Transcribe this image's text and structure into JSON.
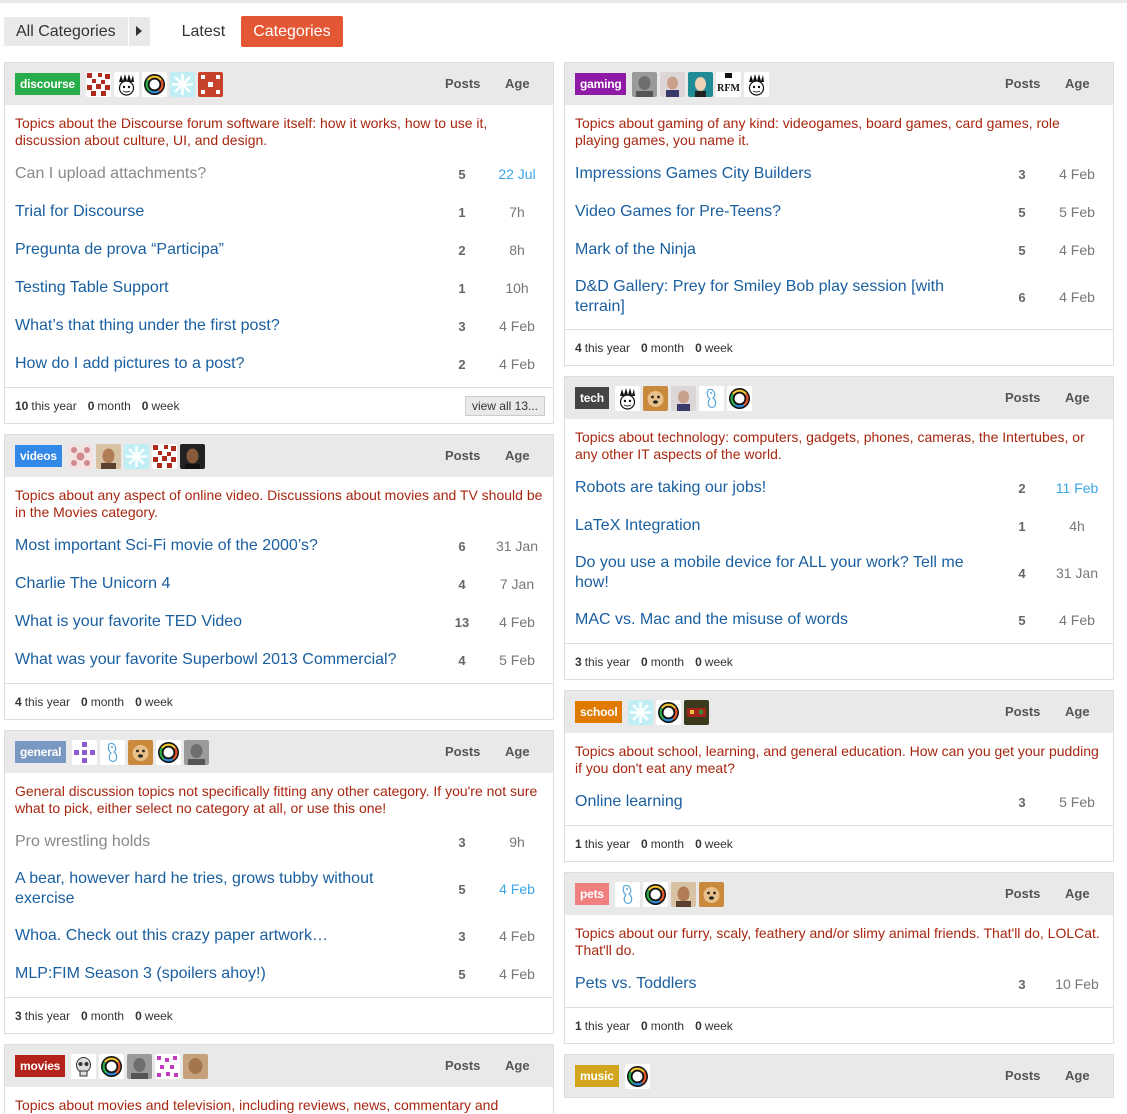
{
  "nav": {
    "all_categories": "All Categories",
    "latest": "Latest",
    "categories": "Categories"
  },
  "headers": {
    "posts": "Posts",
    "age": "Age"
  },
  "left": [
    {
      "badge": "discourse",
      "color": "#27ad4a",
      "avatars": [
        "pattern-red",
        "mohawk",
        "logo-ring",
        "snowflake-cyan",
        "pattern-red2"
      ],
      "description": "Topics about the Discourse forum software itself: how it works, how to use it, discussion about culture, UI, and design.",
      "topics": [
        {
          "title": "Can I upload attachments?",
          "posts": "5",
          "age": "22 Jul",
          "visited": true,
          "new": true
        },
        {
          "title": "Trial for Discourse",
          "posts": "1",
          "age": "7h"
        },
        {
          "title": "Pregunta de prova “Participa”",
          "posts": "2",
          "age": "8h"
        },
        {
          "title": "Testing Table Support",
          "posts": "1",
          "age": "10h"
        },
        {
          "title": "What’s that thing under the first post?",
          "posts": "3",
          "age": "4 Feb"
        },
        {
          "title": "How do I add pictures to a post?",
          "posts": "2",
          "age": "4 Feb"
        }
      ],
      "year": "10",
      "month": "0",
      "week": "0",
      "view_all": "view all 13..."
    },
    {
      "badge": "videos",
      "color": "#3288e6",
      "avatars": [
        "pattern-pink",
        "face-brown",
        "snowflake-cyan",
        "pattern-red",
        "face-dark"
      ],
      "description": "Topics about any aspect of online video. Discussions about movies and TV should be in the Movies category.",
      "topics": [
        {
          "title": "Most important Sci-Fi movie of the 2000’s?",
          "posts": "6",
          "age": "31 Jan"
        },
        {
          "title": "Charlie The Unicorn 4",
          "posts": "4",
          "age": "7 Jan"
        },
        {
          "title": "What is your favorite TED Video",
          "posts": "13",
          "age": "4 Feb"
        },
        {
          "title": "What was your favorite Superbowl 2013 Commercial?",
          "posts": "4",
          "age": "5 Feb"
        }
      ],
      "year": "4",
      "month": "0",
      "week": "0"
    },
    {
      "badge": "general",
      "color": "#7a99c2",
      "avatars": [
        "pattern-purple",
        "sketch",
        "dog",
        "logo-ring",
        "face-grey"
      ],
      "description": "General discussion topics not specifically fitting any other category. If you're not sure what to pick, either select no category at all, or use this one!",
      "topics": [
        {
          "title": "Pro wrestling holds",
          "posts": "3",
          "age": "9h",
          "visited": true
        },
        {
          "title": "A bear, however hard he tries, grows tubby without exercise",
          "posts": "5",
          "age": "4 Feb",
          "new": true
        },
        {
          "title": "Whoa. Check out this crazy paper artwork…",
          "posts": "3",
          "age": "4 Feb"
        },
        {
          "title": "MLP:FIM Season 3 (spoilers ahoy!)",
          "posts": "5",
          "age": "4 Feb"
        }
      ],
      "year": "3",
      "month": "0",
      "week": "0"
    },
    {
      "badge": "movies",
      "color": "#b3231c",
      "avatars": [
        "skull",
        "logo-ring",
        "face-grey",
        "pattern-magenta",
        "face-tan"
      ],
      "description": "Topics about movies and television, including reviews, news, commentary and",
      "topics": []
    }
  ],
  "right": [
    {
      "badge": "gaming",
      "color": "#8e1aa6",
      "avatars": [
        "face-grey",
        "face-light",
        "face-teal",
        "rfm",
        "mohawk"
      ],
      "description": "Topics about gaming of any kind: videogames, board games, card games, role playing games, you name it.",
      "topics": [
        {
          "title": "Impressions Games City Builders",
          "posts": "3",
          "age": "4 Feb"
        },
        {
          "title": "Video Games for Pre-Teens?",
          "posts": "5",
          "age": "5 Feb"
        },
        {
          "title": "Mark of the Ninja",
          "posts": "5",
          "age": "4 Feb"
        },
        {
          "title": "D&D Gallery: Prey for Smiley Bob play session [with terrain]",
          "posts": "6",
          "age": "4 Feb"
        }
      ],
      "year": "4",
      "month": "0",
      "week": "0"
    },
    {
      "badge": "tech",
      "color": "#444444",
      "avatars": [
        "mohawk",
        "dog",
        "face-light",
        "sketch",
        "logo-ring"
      ],
      "description": "Topics about technology: computers, gadgets, phones, cameras, the Intertubes, or any other IT aspects of the world.",
      "topics": [
        {
          "title": "Robots are taking our jobs!",
          "posts": "2",
          "age": "11 Feb",
          "new": true
        },
        {
          "title": "LaTeX Integration",
          "posts": "1",
          "age": "4h"
        },
        {
          "title": "Do you use a mobile device for ALL your work? Tell me how!",
          "posts": "4",
          "age": "31 Jan"
        },
        {
          "title": "MAC vs. Mac and the misuse of words",
          "posts": "5",
          "age": "4 Feb"
        }
      ],
      "year": "3",
      "month": "0",
      "week": "0"
    },
    {
      "badge": "school",
      "color": "#e07a00",
      "avatars": [
        "snowflake-cyan",
        "logo-ring",
        "game"
      ],
      "description": "Topics about school, learning, and general education. How can you get your pudding if you don't eat any meat?",
      "topics": [
        {
          "title": "Online learning",
          "posts": "3",
          "age": "5 Feb"
        }
      ],
      "year": "1",
      "month": "0",
      "week": "0"
    },
    {
      "badge": "pets",
      "color": "#f08080",
      "avatars": [
        "sketch",
        "logo-ring",
        "face-brown",
        "dog"
      ],
      "description": "Topics about our furry, scaly, feathery and/or slimy animal friends. That'll do, LOLCat. That'll do.",
      "topics": [
        {
          "title": "Pets vs. Toddlers",
          "posts": "3",
          "age": "10 Feb"
        }
      ],
      "year": "1",
      "month": "0",
      "week": "0"
    },
    {
      "badge": "music",
      "color": "#d1a51e",
      "avatars": [
        "logo-ring"
      ],
      "description": "",
      "topics": []
    }
  ],
  "labels": {
    "this_year": "this year",
    "month": "month",
    "week": "week"
  }
}
